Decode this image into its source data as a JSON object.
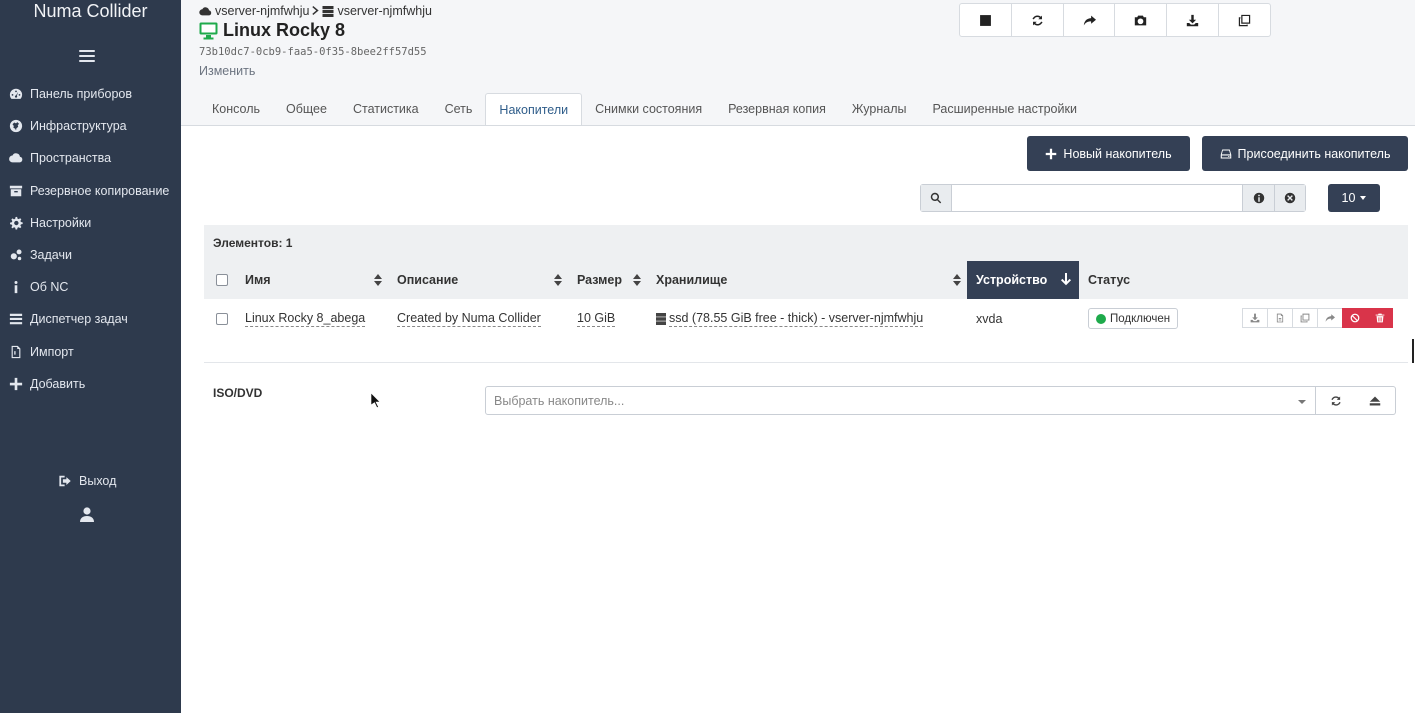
{
  "app": {
    "brand": "Numa Collider"
  },
  "sidebar": {
    "items": [
      {
        "label": "Панель приборов",
        "icon": "dashboard-icon"
      },
      {
        "label": "Инфраструктура",
        "icon": "globe-icon"
      },
      {
        "label": "Пространства",
        "icon": "cloud-icon"
      },
      {
        "label": "Резервное копирование",
        "icon": "archive-icon"
      },
      {
        "label": "Настройки",
        "icon": "gear-icon"
      },
      {
        "label": "Задачи",
        "icon": "cogs-icon"
      },
      {
        "label": "Об NC",
        "icon": "info-icon"
      },
      {
        "label": "Диспетчер задач",
        "icon": "list-icon"
      },
      {
        "label": "Импорт",
        "icon": "import-icon"
      },
      {
        "label": "Добавить",
        "icon": "plus-icon"
      }
    ],
    "logout_label": "Выход"
  },
  "header": {
    "breadcrumb": {
      "pool": "vserver-njmfwhju",
      "host": "vserver-njmfwhju"
    },
    "vm_name": "Linux Rocky 8",
    "vm_uuid": "73b10dc7-0cb9-faa5-0f35-8bee2ff57d55",
    "edit_label": "Изменить"
  },
  "tabs": [
    {
      "label": "Консоль",
      "active": false
    },
    {
      "label": "Общее",
      "active": false
    },
    {
      "label": "Статистика",
      "active": false
    },
    {
      "label": "Сеть",
      "active": false
    },
    {
      "label": "Накопители",
      "active": true
    },
    {
      "label": "Снимки состояния",
      "active": false
    },
    {
      "label": "Резервная копия",
      "active": false
    },
    {
      "label": "Журналы",
      "active": false
    },
    {
      "label": "Расширенные настройки",
      "active": false
    }
  ],
  "disks": {
    "new_disk_label": "Новый накопитель",
    "attach_disk_label": "Присоединить накопитель",
    "search_placeholder": "",
    "per_page": "10",
    "count_label": "Элементов: 1",
    "columns": {
      "name": "Имя",
      "description": "Описание",
      "size": "Размер",
      "storage": "Хранилище",
      "device": "Устройство",
      "status": "Статус"
    },
    "rows": [
      {
        "name": "Linux Rocky 8_abega",
        "description": "Created by Numa Collider",
        "size": "10 GiB",
        "storage": "ssd (78.55 GiB free - thick) - vserver-njmfwhju",
        "device": "xvda",
        "status": "Подключен"
      }
    ]
  },
  "iso": {
    "label": "ISO/DVD",
    "select_placeholder": "Выбрать накопитель..."
  },
  "colors": {
    "sidebar_bg": "#2e3a4d",
    "accent_dark": "#344055",
    "danger": "#d9344a",
    "status_ok": "#1eaa4b"
  }
}
